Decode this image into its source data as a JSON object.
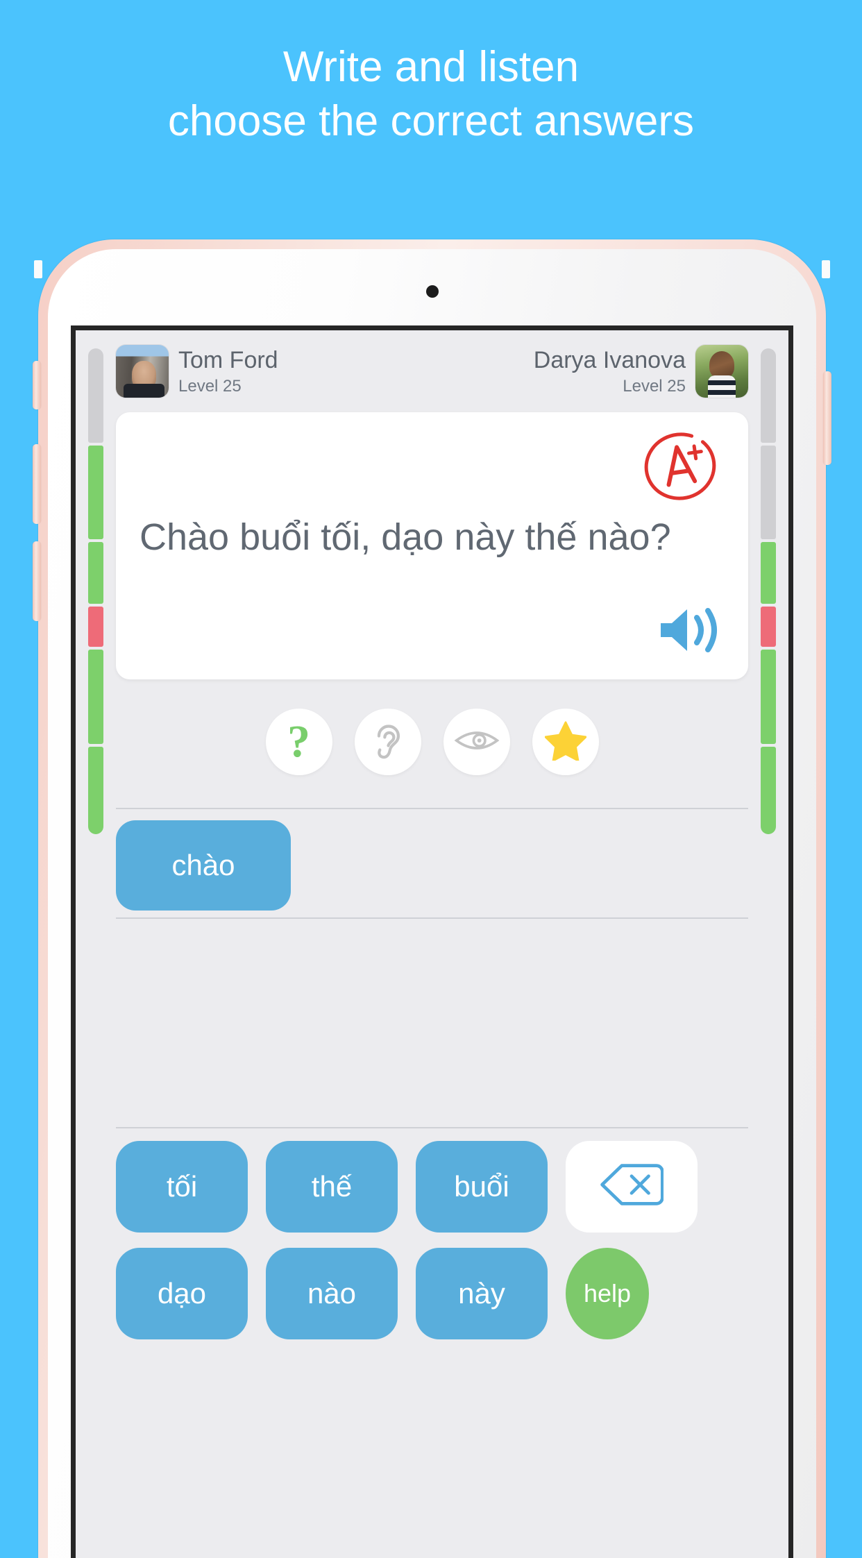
{
  "promo": {
    "line1": "Write and listen",
    "line2": "choose the correct answers",
    "background_color": "#4BC3FD",
    "text_color": "#FFFFFF"
  },
  "device": {
    "frame_color": "#F5D5CC",
    "screen_border_color": "#262626",
    "screen_background": "#ECECEF"
  },
  "app": {
    "players": [
      {
        "name": "Tom Ford",
        "level": "Level 25",
        "side": "left",
        "avatar": "photo-man-city"
      },
      {
        "name": "Darya Ivanova",
        "level": "Level 25",
        "side": "right",
        "avatar": "photo-woman-forest"
      }
    ],
    "health_bars": {
      "left": [
        {
          "state": "empty",
          "color": "#CFCFD2"
        },
        {
          "state": "correct",
          "color": "#7DD06B"
        },
        {
          "state": "correct",
          "color": "#7DD06B"
        },
        {
          "state": "wrong",
          "color": "#EE6B78"
        },
        {
          "state": "correct",
          "color": "#7DD06B"
        },
        {
          "state": "correct",
          "color": "#7DD06B"
        }
      ],
      "right": [
        {
          "state": "empty",
          "color": "#CFCFD2"
        },
        {
          "state": "empty",
          "color": "#CFCFD2"
        },
        {
          "state": "correct",
          "color": "#7DD06B"
        },
        {
          "state": "wrong",
          "color": "#EE6B78"
        },
        {
          "state": "correct",
          "color": "#7DD06B"
        },
        {
          "state": "correct",
          "color": "#7DD06B"
        }
      ]
    },
    "card": {
      "question": "Chào buổi tối, dạo này thế nào?",
      "grade_stamp": "A+",
      "grade_stamp_color": "#E0332E",
      "speaker_icon": "speaker-icon",
      "speaker_color": "#4FA8DC",
      "background": "#FFFFFF"
    },
    "helpers": [
      {
        "name": "hint-question",
        "icon": "question-mark-icon",
        "glyph": "?",
        "color": "#79CE6C"
      },
      {
        "name": "listen",
        "icon": "ear-icon",
        "glyph": "",
        "color": "#BDBDBD"
      },
      {
        "name": "reveal",
        "icon": "eye-icon",
        "glyph": "",
        "color": "#BDBDBD"
      },
      {
        "name": "favorite",
        "icon": "star-icon",
        "glyph": "★",
        "color": "#FCD236"
      }
    ],
    "answer_slot": {
      "words": [
        "chào"
      ],
      "tile_color": "#59AEDC",
      "tile_text_color": "#FFFFFF"
    },
    "word_bank": {
      "rows": [
        [
          {
            "label": "tối",
            "type": "word",
            "color": "#59AEDC"
          },
          {
            "label": "thế",
            "type": "word",
            "color": "#59AEDC"
          },
          {
            "label": "buổi",
            "type": "word",
            "color": "#59AEDC"
          },
          {
            "label": "",
            "type": "backspace",
            "icon": "backspace-icon",
            "color": "#FFFFFF",
            "icon_color": "#4FA8DC"
          }
        ],
        [
          {
            "label": "dạo",
            "type": "word",
            "color": "#59AEDC"
          },
          {
            "label": "nào",
            "type": "word",
            "color": "#59AEDC"
          },
          {
            "label": "này",
            "type": "word",
            "color": "#59AEDC"
          },
          {
            "label": "help",
            "type": "help",
            "color": "#7DC96B"
          }
        ]
      ]
    }
  }
}
